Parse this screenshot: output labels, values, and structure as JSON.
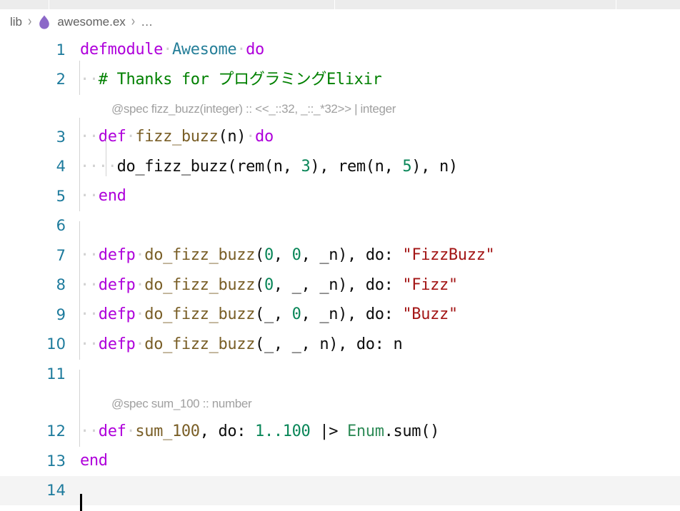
{
  "window": {
    "background": "#ffffff",
    "tab_strip_color": "#ececec"
  },
  "breadcrumb": {
    "items": [
      {
        "label": "lib",
        "icon": null
      },
      {
        "label": "awesome.ex",
        "icon": "elixir-droplet-icon"
      },
      {
        "label": "...",
        "icon": null
      }
    ],
    "separator": "›",
    "lib_label": "lib",
    "file_label": "awesome.ex",
    "ellipsis_label": "…"
  },
  "editor": {
    "language": "elixir",
    "file_name": "awesome.ex",
    "cursor_line": 14,
    "cursor_column": 1,
    "active_line": 14,
    "render_whitespace": true,
    "indent_guides": true,
    "colors": {
      "keyword": "#af00db",
      "type": "#267f99",
      "comment": "#008000",
      "function": "#795e26",
      "number": "#098658",
      "string": "#a31515",
      "module": "#2e8b57",
      "plain": "#0d0d0d",
      "line_number": "#1c7a9c",
      "inlay_hint": "#a0a0a0",
      "indent_guide": "#d3d3d3",
      "active_line": "#f4f4f4",
      "whitespace_dot": "#d0d0d0"
    },
    "lines": [
      {
        "number": "1",
        "text": "defmodule Awesome do"
      },
      {
        "number": "2",
        "text": "  # Thanks for プログラミングElixir"
      },
      {
        "number": "3",
        "text": "  def fizz_buzz(n) do"
      },
      {
        "number": "4",
        "text": "    do_fizz_buzz(rem(n, 3), rem(n, 5), n)"
      },
      {
        "number": "5",
        "text": "  end"
      },
      {
        "number": "6",
        "text": ""
      },
      {
        "number": "7",
        "text": "  defp do_fizz_buzz(0, 0, _n), do: \"FizzBuzz\""
      },
      {
        "number": "8",
        "text": "  defp do_fizz_buzz(0, _, _n), do: \"Fizz\""
      },
      {
        "number": "9",
        "text": "  defp do_fizz_buzz(_, 0, _n), do: \"Buzz\""
      },
      {
        "number": "10",
        "text": "  defp do_fizz_buzz(_, _, n), do: n"
      },
      {
        "number": "11",
        "text": ""
      },
      {
        "number": "12",
        "text": "  def sum_100, do: 1..100 |> Enum.sum()"
      },
      {
        "number": "13",
        "text": "end"
      },
      {
        "number": "14",
        "text": ""
      }
    ],
    "inlay_hints": [
      {
        "after_line": "2",
        "text": "@spec fizz_buzz(integer) :: <<_::32, _::_*32>> | integer"
      },
      {
        "after_line": "11",
        "text": "@spec sum_100 :: number"
      }
    ],
    "tokens": {
      "l1_defmodule": "defmodule",
      "l1_awesome": "Awesome",
      "l1_do": "do",
      "l2_comment": "# Thanks for プログラミングElixir",
      "l3_def": "def",
      "l3_name": "fizz_buzz",
      "l3_args": "(n)",
      "l3_do": "do",
      "l4_call": "do_fizz_buzz(rem(n, ",
      "l4_n3": "3",
      "l4_mid": "), rem(n, ",
      "l4_n5": "5",
      "l4_tail": "), n)",
      "l5_end": "end",
      "l7_defp": "defp",
      "l7_name": "do_fizz_buzz",
      "l7_open": "(",
      "l7_a1": "0",
      "l7_c1": ", ",
      "l7_a2": "0",
      "l7_rest": ", _n), do: ",
      "l7_str": "\"FizzBuzz\"",
      "l8_defp": "defp",
      "l8_name": "do_fizz_buzz",
      "l8_open": "(",
      "l8_a1": "0",
      "l8_rest": ", _, _n), do: ",
      "l8_str": "\"Fizz\"",
      "l9_defp": "defp",
      "l9_name": "do_fizz_buzz",
      "l9_open": "(_, ",
      "l9_a2": "0",
      "l9_rest": ", _n), do: ",
      "l9_str": "\"Buzz\"",
      "l10_defp": "defp",
      "l10_name": "do_fizz_buzz",
      "l10_rest": "(_, _, n), do: n",
      "l12_def": "def",
      "l12_name": "sum_100",
      "l12_mid": ", do: ",
      "l12_range": "1..100",
      "l12_pipe": " |> ",
      "l12_mod": "Enum",
      "l12_call": ".sum()",
      "l13_end": "end"
    }
  }
}
